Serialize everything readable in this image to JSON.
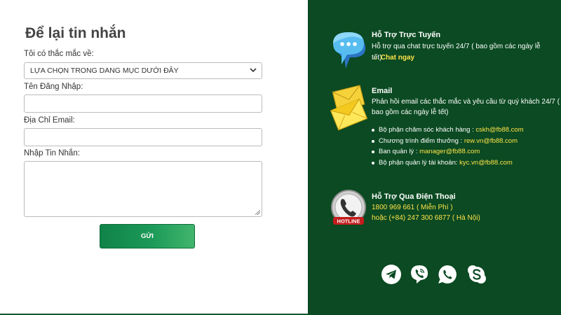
{
  "form": {
    "title": "Để lại tin nhắn",
    "topic_label": "Tôi có thắc mắc về:",
    "topic_value": "LỰA CHỌN TRONG DANG MỤC DƯỚI ĐÂY",
    "username_label": "Tên Đăng Nhập:",
    "username_value": "",
    "email_label": "Địa Chỉ Email:",
    "email_value": "",
    "message_label": "Nhập Tin Nhắn:",
    "message_value": "",
    "submit_label": "GỬI"
  },
  "support": {
    "chat": {
      "title": "Hỗ Trợ Trực Tuyến",
      "text": "Hỗ trợ qua chat trực tuyến 24/7 ( bao gồm các ngày lễ tết).",
      "link_prefix": "→",
      "link_label": "Chat ngay"
    },
    "email": {
      "title": "Email",
      "text_line1": "Phản hồi email các thắc mắc và yêu cầu từ quý khách 24/7 (",
      "text_line2": "bao gồm các ngày lễ tết)",
      "contacts": [
        {
          "label": "Bộ phận chăm sóc khách hàng : ",
          "email": "cskh@fb88.com"
        },
        {
          "label": "Chương trình điểm thưởng : ",
          "email": "rew.vn@fb88.com"
        },
        {
          "label": "Ban quản lý : ",
          "email": "manager@fb88.com"
        },
        {
          "label": "Bộ phận quản lý tài khoản: ",
          "email": "kyc.vn@fb88.com"
        }
      ]
    },
    "phone": {
      "title": "Hỗ Trợ Qua Điện Thoại",
      "line1": "1800 969 661 ( Miễn Phí )",
      "line2": "hoặc (+84) 247 300 6877 ( Hà Nội)",
      "badge": "HOTLINE"
    }
  },
  "social_icons": [
    "telegram-icon",
    "viber-icon",
    "whatsapp-icon",
    "skype-icon"
  ],
  "colors": {
    "panel_bg": "#0b4a22",
    "accent_yellow": "#ffe34a",
    "button_green": "#108348"
  }
}
